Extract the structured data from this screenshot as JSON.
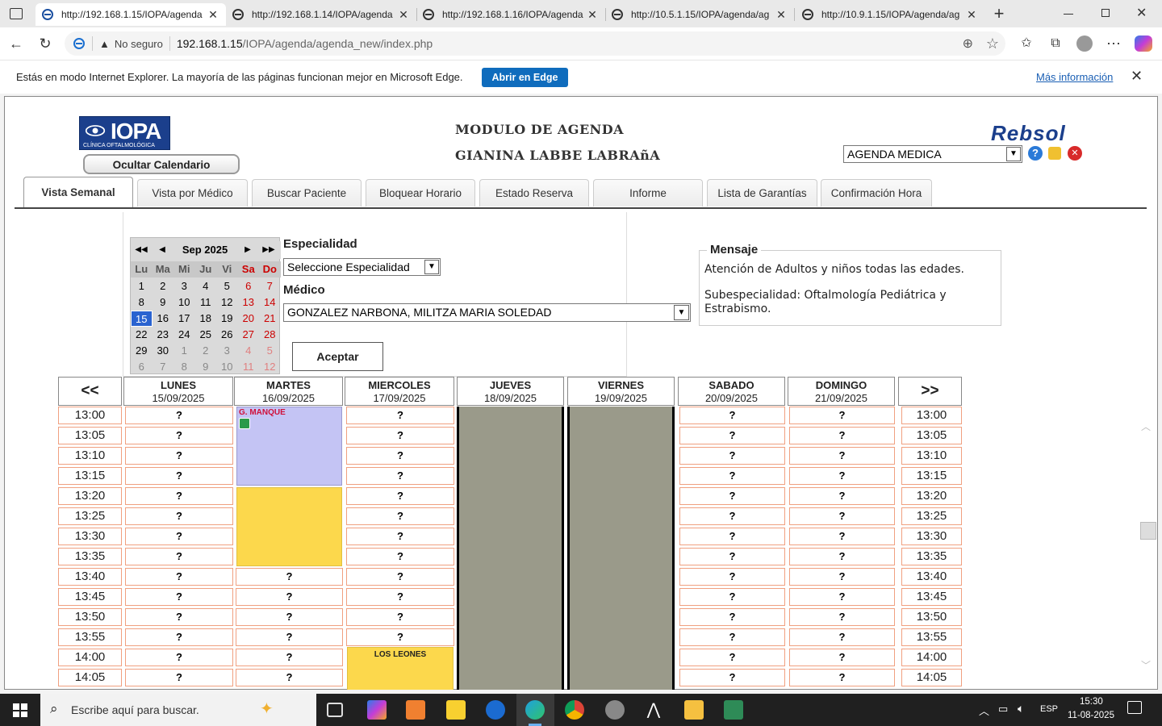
{
  "browser": {
    "tabs": [
      {
        "title": "http://192.168.1.15/IOPA/agenda",
        "active": true
      },
      {
        "title": "http://192.168.1.14/IOPA/agenda",
        "active": false
      },
      {
        "title": "http://192.168.1.16/IOPA/agenda",
        "active": false
      },
      {
        "title": "http://10.5.1.15/IOPA/agenda/ag",
        "active": false
      },
      {
        "title": "http://10.9.1.15/IOPA/agenda/ag",
        "active": false
      }
    ],
    "new_tab": "+",
    "not_secure": "No seguro",
    "url_host": "192.168.1.15",
    "url_path": "/IOPA/agenda/agenda_new/index.php"
  },
  "infobar": {
    "message": "Estás en modo Internet Explorer. La mayoría de las páginas funcionan mejor en Microsoft Edge.",
    "open_button": "Abrir en Edge",
    "more_link": "Más información"
  },
  "header": {
    "logo_text": "IOPA",
    "logo_subtext": "CLÍNICA OFTALMOLÓGICA",
    "hide_calendar": "Ocultar Calendario",
    "title": "MODULO DE AGENDA",
    "user": "GIANINA LABBE LABRAñA",
    "brand": "Rebsol",
    "module_select": "AGENDA MEDICA",
    "help_icon": "?"
  },
  "nav_tabs": [
    "Vista Semanal",
    "Vista por Médico",
    "Buscar Paciente",
    "Bloquear Horario",
    "Estado Reserva",
    "Informe",
    "Lista de Garantías",
    "Confirmación Hora"
  ],
  "calendar": {
    "month": "Sep 2025",
    "weekdays": [
      "Lu",
      "Ma",
      "Mi",
      "Ju",
      "Vi",
      "Sa",
      "Do"
    ],
    "weeks": [
      [
        "1",
        "2",
        "3",
        "4",
        "5",
        "6",
        "7"
      ],
      [
        "8",
        "9",
        "10",
        "11",
        "12",
        "13",
        "14"
      ],
      [
        "15",
        "16",
        "17",
        "18",
        "19",
        "20",
        "21"
      ],
      [
        "22",
        "23",
        "24",
        "25",
        "26",
        "27",
        "28"
      ],
      [
        "29",
        "30",
        "1",
        "2",
        "3",
        "4",
        "5"
      ],
      [
        "6",
        "7",
        "8",
        "9",
        "10",
        "11",
        "12"
      ]
    ],
    "today": "15"
  },
  "filters": {
    "specialty_label": "Especialidad",
    "specialty_value": "Seleccione Especialidad",
    "doctor_label": "Médico",
    "doctor_value": "GONZALEZ NARBONA, MILITZA MARIA SOLEDAD",
    "accept": "Aceptar"
  },
  "message": {
    "legend": "Mensaje",
    "line1": "Atención de Adultos y niños todas las edades.",
    "line2": "Subespecialidad: Oftalmología Pediátrica y Estrabismo."
  },
  "week": {
    "prev": "<<",
    "next": ">>",
    "days": [
      {
        "name": "LUNES",
        "date": "15/09/2025"
      },
      {
        "name": "MARTES",
        "date": "16/09/2025"
      },
      {
        "name": "MIERCOLES",
        "date": "17/09/2025"
      },
      {
        "name": "JUEVES",
        "date": "18/09/2025"
      },
      {
        "name": "VIERNES",
        "date": "19/09/2025"
      },
      {
        "name": "SABADO",
        "date": "20/09/2025"
      },
      {
        "name": "DOMINGO",
        "date": "21/09/2025"
      }
    ],
    "times": [
      "13:00",
      "13:05",
      "13:10",
      "13:15",
      "13:20",
      "13:25",
      "13:30",
      "13:35",
      "13:40",
      "13:45",
      "13:50",
      "13:55",
      "14:00",
      "14:05"
    ],
    "free_mark": "?",
    "appointment_1": "G. MANQUE",
    "appointment_2": "LOS LEONES"
  },
  "taskbar": {
    "search_placeholder": "Escribe aquí para buscar.",
    "lang": "ESP",
    "time": "15:30",
    "date": "11-08-2025"
  },
  "colors": {
    "appointment_purple": "#c4c4f4",
    "appointment_yellow": "#fcd84c",
    "blocked_gray": "#9a9a8a",
    "slot_border": "#f0a080",
    "edge_blue": "#0f6cbd"
  }
}
